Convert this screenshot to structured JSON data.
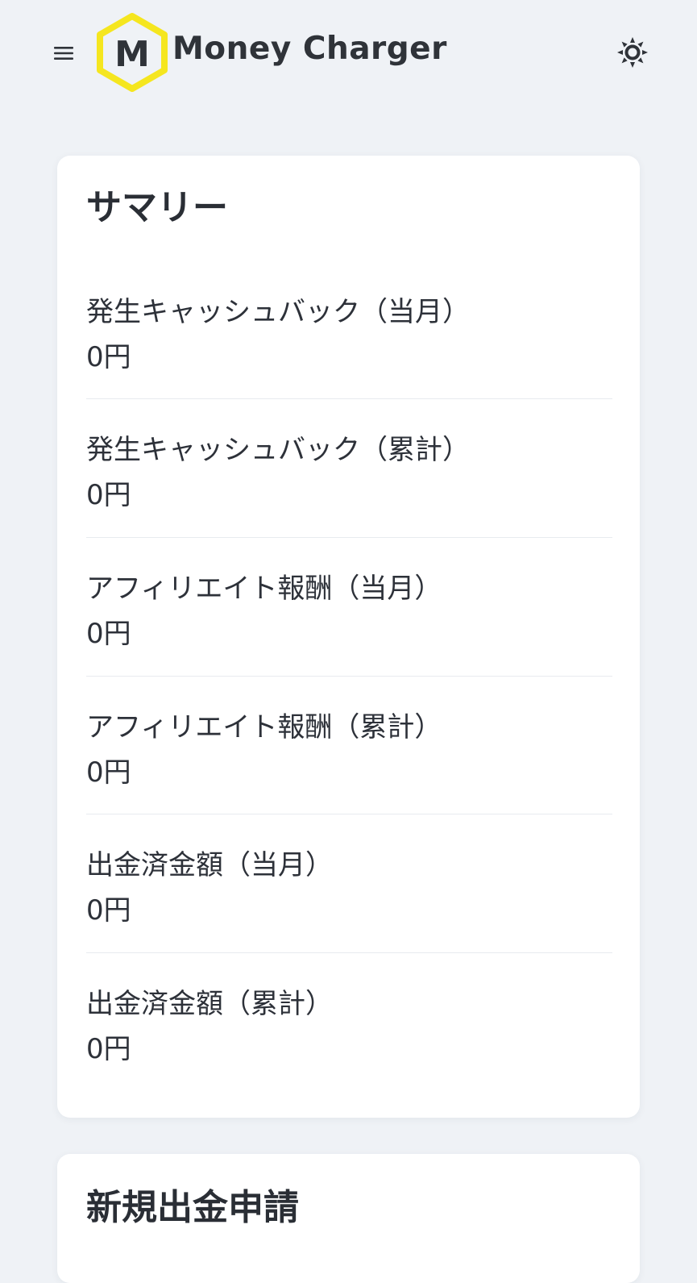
{
  "header": {
    "logo_letter": "M",
    "app_name": "Money Charger",
    "menu_icon": "hamburger-menu-icon",
    "theme_icon": "sun-icon",
    "brand_color": "#f5e61f"
  },
  "summary": {
    "title": "サマリー",
    "items": [
      {
        "label": "発生キャッシュバック（当月）",
        "value": "0円"
      },
      {
        "label": "発生キャッシュバック（累計）",
        "value": "0円"
      },
      {
        "label": "アフィリエイト報酬（当月）",
        "value": "0円"
      },
      {
        "label": "アフィリエイト報酬（累計）",
        "value": "0円"
      },
      {
        "label": "出金済金額（当月）",
        "value": "0円"
      },
      {
        "label": "出金済金額（累計）",
        "value": "0円"
      }
    ]
  },
  "withdraw": {
    "title": "新規出金申請"
  }
}
